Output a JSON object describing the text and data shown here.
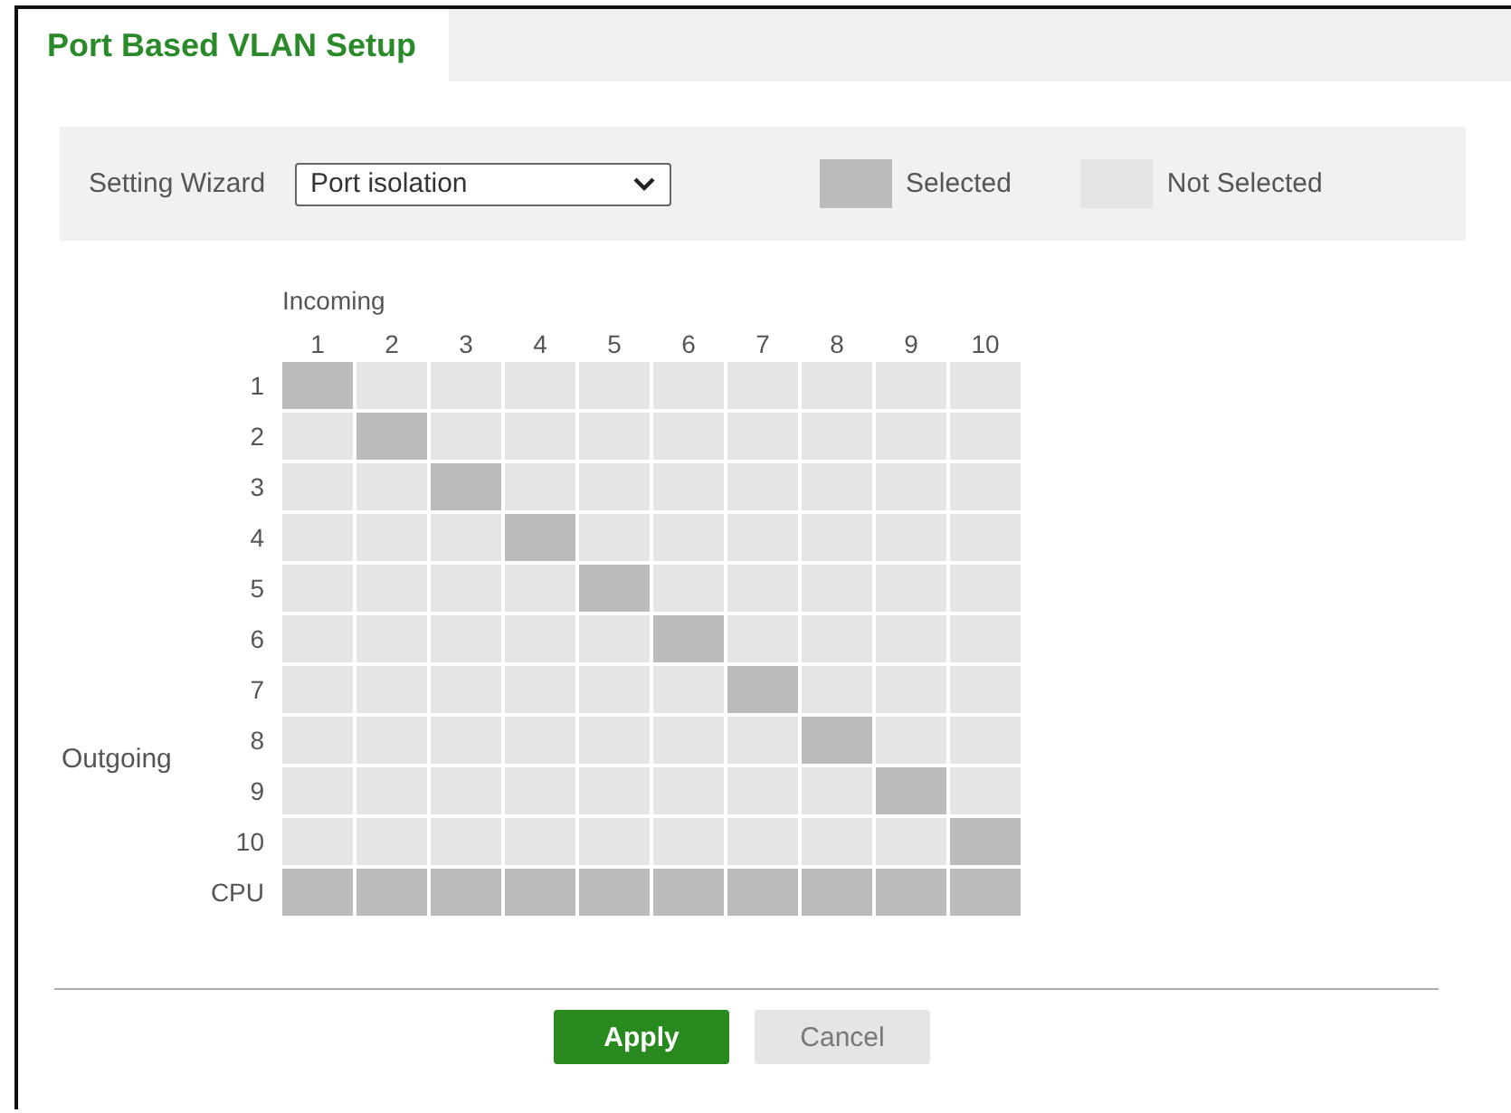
{
  "tab": {
    "label": "Port Based VLAN Setup",
    "selected": true
  },
  "wizard": {
    "label": "Setting Wizard",
    "value": "Port isolation"
  },
  "legend": [
    {
      "label": "Selected",
      "selected": true
    },
    {
      "label": "Not Selected",
      "selected": false
    }
  ],
  "matrix": {
    "column_title": "Incoming",
    "row_title": "Outgoing",
    "columns": [
      "1",
      "2",
      "3",
      "4",
      "5",
      "6",
      "7",
      "8",
      "9",
      "10"
    ],
    "rows": [
      {
        "label": "1",
        "cells": [
          true,
          false,
          false,
          false,
          false,
          false,
          false,
          false,
          false,
          false
        ]
      },
      {
        "label": "2",
        "cells": [
          false,
          true,
          false,
          false,
          false,
          false,
          false,
          false,
          false,
          false
        ]
      },
      {
        "label": "3",
        "cells": [
          false,
          false,
          true,
          false,
          false,
          false,
          false,
          false,
          false,
          false
        ]
      },
      {
        "label": "4",
        "cells": [
          false,
          false,
          false,
          true,
          false,
          false,
          false,
          false,
          false,
          false
        ]
      },
      {
        "label": "5",
        "cells": [
          false,
          false,
          false,
          false,
          true,
          false,
          false,
          false,
          false,
          false
        ]
      },
      {
        "label": "6",
        "cells": [
          false,
          false,
          false,
          false,
          false,
          true,
          false,
          false,
          false,
          false
        ]
      },
      {
        "label": "7",
        "cells": [
          false,
          false,
          false,
          false,
          false,
          false,
          true,
          false,
          false,
          false
        ]
      },
      {
        "label": "8",
        "cells": [
          false,
          false,
          false,
          false,
          false,
          false,
          false,
          true,
          false,
          false
        ]
      },
      {
        "label": "9",
        "cells": [
          false,
          false,
          false,
          false,
          false,
          false,
          false,
          false,
          true,
          false
        ]
      },
      {
        "label": "10",
        "cells": [
          false,
          false,
          false,
          false,
          false,
          false,
          false,
          false,
          false,
          true
        ]
      },
      {
        "label": "CPU",
        "cells": [
          true,
          true,
          true,
          true,
          true,
          true,
          true,
          true,
          true,
          true
        ]
      }
    ]
  },
  "buttons": [
    {
      "label": "Apply",
      "kind": "primary"
    },
    {
      "label": "Cancel",
      "kind": "secondary"
    }
  ]
}
